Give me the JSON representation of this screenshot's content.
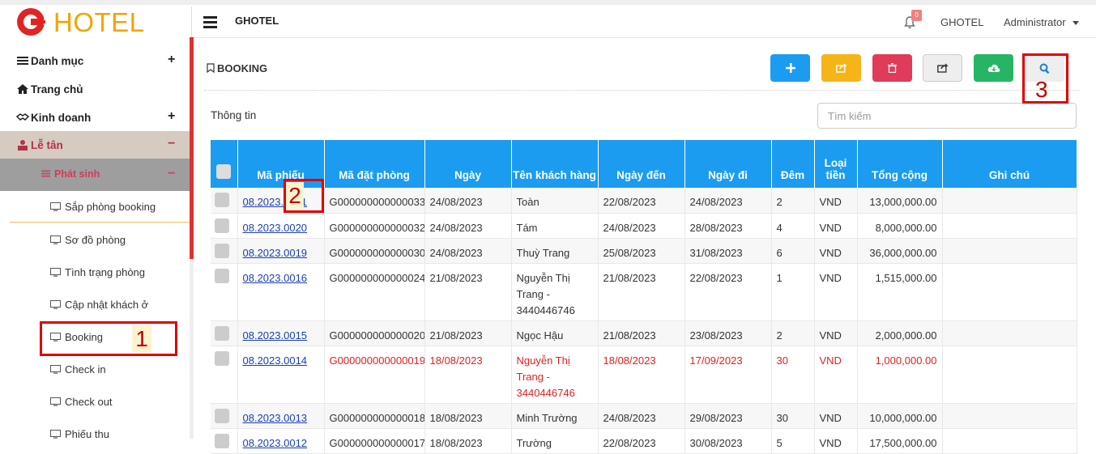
{
  "brand": {
    "logo_letter": "G",
    "logo_text": "HOTEL"
  },
  "header": {
    "app_title": "GHOTEL",
    "notifications": "0",
    "user_org": "GHOTEL",
    "user_name": "Administrator"
  },
  "sidebar": {
    "items": [
      {
        "label": "Danh mục",
        "icon": "list-icon",
        "toggle": "+"
      },
      {
        "label": "Trang chủ",
        "icon": "home-icon",
        "toggle": ""
      },
      {
        "label": "Kinh doanh",
        "icon": "handshake-icon",
        "toggle": "+"
      },
      {
        "label": "Lễ tân",
        "icon": "reception-icon",
        "toggle": "−"
      }
    ],
    "group": {
      "label": "Phát sinh",
      "icon": "list-icon",
      "toggle": "−"
    },
    "subitems": [
      "Sắp phòng booking",
      "Sơ đồ phòng",
      "Tình trạng phòng",
      "Cập nhật khách ở",
      "Booking",
      "Check in",
      "Check out",
      "Phiếu thu"
    ],
    "active": "Booking"
  },
  "page": {
    "title": "BOOKING",
    "section_label": "Thông tin",
    "search_placeholder": "Tìm kiếm",
    "toolbar": [
      {
        "name": "add-button",
        "icon": "plus-icon",
        "color": "#1b9cf0"
      },
      {
        "name": "export-button",
        "icon": "share-icon",
        "color": "#f5b417"
      },
      {
        "name": "delete-button",
        "icon": "trash-icon",
        "color": "#e03c5a"
      },
      {
        "name": "share-button",
        "icon": "share-icon",
        "color": "#eeeeee"
      },
      {
        "name": "download-button",
        "icon": "cloud-download-icon",
        "color": "#25b565"
      },
      {
        "name": "search-button",
        "icon": "search-icon",
        "color": "#eeeeee"
      }
    ]
  },
  "table": {
    "columns": [
      "Mã phiếu",
      "Mã đặt phòng",
      "Ngày",
      "Tên khách hàng",
      "Ngày đến",
      "Ngày đi",
      "Đêm",
      "Loại tiền",
      "Tổng cộng",
      "Ghi chú"
    ],
    "rows": [
      {
        "ma_phieu": "08.2023.0021",
        "ma_dat_phong": "G000000000000033",
        "ngay": "24/08/2023",
        "ten_kh": "Toàn",
        "ngay_den": "22/08/2023",
        "ngay_di": "24/08/2023",
        "dem": "2",
        "loai_tien": "VND",
        "tong": "13,000,000.00",
        "ghi_chu": "",
        "highlight": false
      },
      {
        "ma_phieu": "08.2023.0020",
        "ma_dat_phong": "G000000000000032",
        "ngay": "24/08/2023",
        "ten_kh": "Tám",
        "ngay_den": "24/08/2023",
        "ngay_di": "28/08/2023",
        "dem": "4",
        "loai_tien": "VND",
        "tong": "8,000,000.00",
        "ghi_chu": "",
        "highlight": false
      },
      {
        "ma_phieu": "08.2023.0019",
        "ma_dat_phong": "G000000000000030",
        "ngay": "24/08/2023",
        "ten_kh": "Thuỳ Trang",
        "ngay_den": "25/08/2023",
        "ngay_di": "31/08/2023",
        "dem": "6",
        "loai_tien": "VND",
        "tong": "36,000,000.00",
        "ghi_chu": "",
        "highlight": false
      },
      {
        "ma_phieu": "08.2023.0016",
        "ma_dat_phong": "G000000000000024",
        "ngay": "21/08/2023",
        "ten_kh": "Nguyễn Thị Trang - 3440446746",
        "ngay_den": "21/08/2023",
        "ngay_di": "22/08/2023",
        "dem": "1",
        "loai_tien": "VND",
        "tong": "1,515,000.00",
        "ghi_chu": "",
        "highlight": false
      },
      {
        "ma_phieu": "08.2023.0015",
        "ma_dat_phong": "G000000000000020",
        "ngay": "21/08/2023",
        "ten_kh": "Ngọc Hậu",
        "ngay_den": "21/08/2023",
        "ngay_di": "23/08/2023",
        "dem": "2",
        "loai_tien": "VND",
        "tong": "2,000,000.00",
        "ghi_chu": "",
        "highlight": false
      },
      {
        "ma_phieu": "08.2023.0014",
        "ma_dat_phong": "G000000000000019",
        "ngay": "18/08/2023",
        "ten_kh": "Nguyễn Thị Trang - 3440446746",
        "ngay_den": "18/08/2023",
        "ngay_di": "17/09/2023",
        "dem": "30",
        "loai_tien": "VND",
        "tong": "1,000,000.00",
        "ghi_chu": "",
        "highlight": true
      },
      {
        "ma_phieu": "08.2023.0013",
        "ma_dat_phong": "G000000000000018",
        "ngay": "18/08/2023",
        "ten_kh": "Minh Trường",
        "ngay_den": "24/08/2023",
        "ngay_di": "29/08/2023",
        "dem": "30",
        "loai_tien": "VND",
        "tong": "10,000,000.00",
        "ghi_chu": "",
        "highlight": false
      },
      {
        "ma_phieu": "08.2023.0012",
        "ma_dat_phong": "G000000000000017",
        "ngay": "18/08/2023",
        "ten_kh": "Trường",
        "ngay_den": "22/08/2023",
        "ngay_di": "30/08/2023",
        "dem": "5",
        "loai_tien": "VND",
        "tong": "17,500,000.00",
        "ghi_chu": "",
        "highlight": false
      }
    ]
  },
  "annotations": {
    "a1": "1",
    "a2": "2",
    "a3": "3",
    "color": "#e00000"
  }
}
